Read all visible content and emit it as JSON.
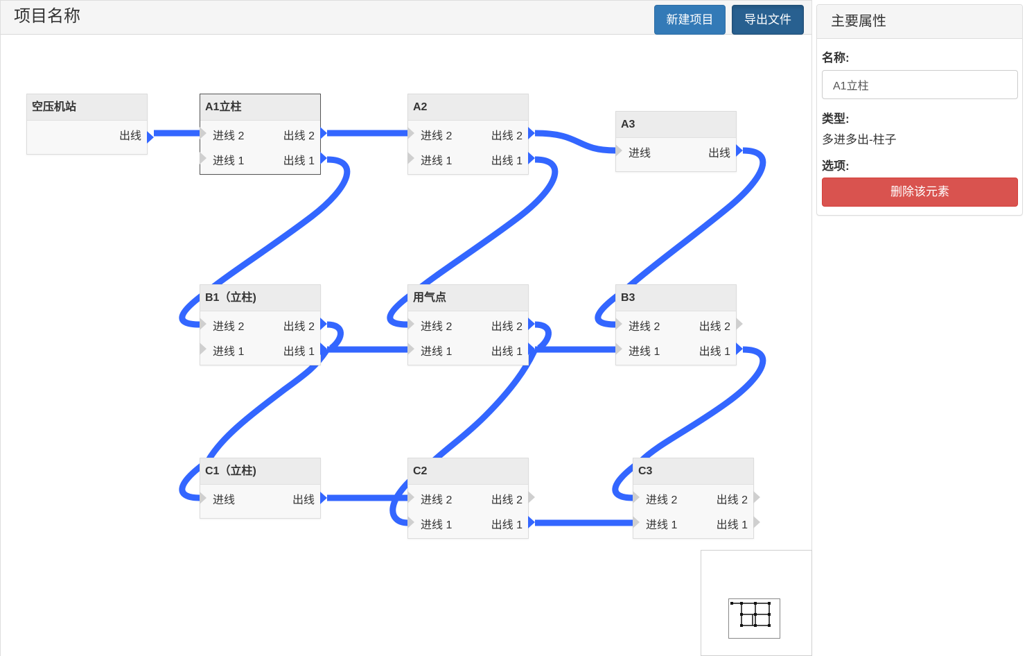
{
  "header": {
    "title": "项目名称",
    "new_project_label": "新建项目",
    "export_label": "导出文件"
  },
  "nodes": {
    "compressor": {
      "title": "空压机站",
      "out": "出线"
    },
    "a1": {
      "title": "A1立柱",
      "in2": "进线 2",
      "out2": "出线 2",
      "in1": "进线 1",
      "out1": "出线 1"
    },
    "a2": {
      "title": "A2",
      "in2": "进线 2",
      "out2": "出线 2",
      "in1": "进线 1",
      "out1": "出线 1"
    },
    "a3": {
      "title": "A3",
      "in": "进线",
      "out": "出线"
    },
    "b1": {
      "title": "B1（立柱)",
      "in2": "进线 2",
      "out2": "出线 2",
      "in1": "进线 1",
      "out1": "出线 1"
    },
    "gas_point": {
      "title": "用气点",
      "in2": "进线 2",
      "out2": "出线 2",
      "in1": "进线 1",
      "out1": "出线 1"
    },
    "b3": {
      "title": "B3",
      "in2": "进线 2",
      "out2": "出线 2",
      "in1": "进线 1",
      "out1": "出线 1"
    },
    "c1": {
      "title": "C1（立柱)",
      "in": "进线",
      "out": "出线"
    },
    "c2": {
      "title": "C2",
      "in2": "进线 2",
      "out2": "出线 2",
      "in1": "进线 1",
      "out1": "出线 1"
    },
    "c3": {
      "title": "C3",
      "in2": "进线 2",
      "out2": "出线 2",
      "in1": "进线 1",
      "out1": "出线 1"
    }
  },
  "properties": {
    "heading": "主要属性",
    "name_label": "名称:",
    "name_value": "A1立柱",
    "type_label": "类型:",
    "type_value": "多进多出-柱子",
    "options_label": "选项:",
    "delete_label": "删除该元素"
  },
  "colors": {
    "link": "#3366ff",
    "primary": "#337ab7",
    "danger": "#d9534f"
  }
}
